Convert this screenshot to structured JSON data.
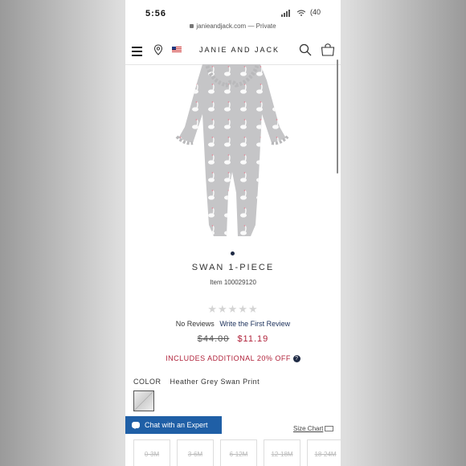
{
  "status_bar": {
    "time": "5:56",
    "battery": "(40"
  },
  "browser": {
    "url": "janieandjack.com",
    "mode": "— Private"
  },
  "header": {
    "brand": "JANIE AND JACK"
  },
  "product": {
    "title": "SWAN 1-PIECE",
    "item_number": "Item 100029120",
    "rating_stars": "★★★★★",
    "reviews_count": "No Reviews",
    "write_review": "Write the First Review",
    "original_price": "$44.00",
    "sale_price": "$11.19",
    "discount_note": "INCLUDES ADDITIONAL 20% OFF",
    "color_label": "COLOR",
    "color_value": "Heather Grey Swan Print"
  },
  "chat": {
    "label": "Chat with an Expert"
  },
  "size_chart": {
    "label": "Size Chart"
  },
  "sizes": [
    "0-3M",
    "3-6M",
    "6-12M",
    "12-18M",
    "18-24M"
  ],
  "colors": {
    "accent_navy": "#1e2a44",
    "sale_red": "#b0223a",
    "chat_blue": "#1f5fa6"
  }
}
